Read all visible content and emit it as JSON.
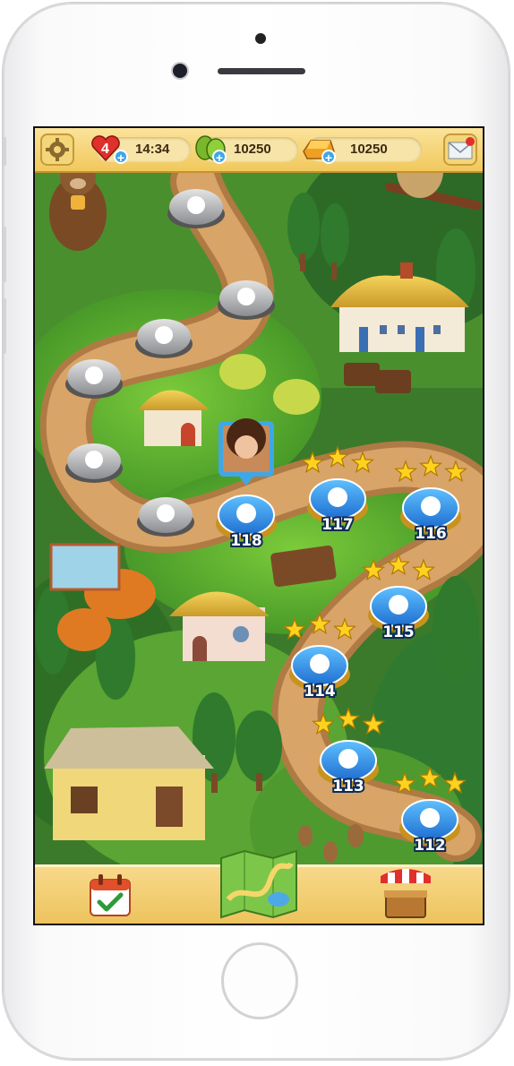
{
  "hud": {
    "lives": "4",
    "timer": "14:34",
    "boosters": "10250",
    "gold": "10250"
  },
  "levels": {
    "completed": [
      {
        "number": "118",
        "stars": 0
      },
      {
        "number": "117",
        "stars": 3
      },
      {
        "number": "116",
        "stars": 3
      },
      {
        "number": "115",
        "stars": 3
      },
      {
        "number": "114",
        "stars": 3
      },
      {
        "number": "113",
        "stars": 3
      },
      {
        "number": "112",
        "stars": 3
      }
    ],
    "current_level": "118"
  },
  "icons": {
    "settings": "gear-icon",
    "mail": "envelope-icon",
    "daily": "calendar-check-icon",
    "map": "map-icon",
    "shop": "market-stall-icon"
  },
  "colors": {
    "accent": "#3fa7e6",
    "hud_bar": "#f1c85c",
    "completed_node": "#3b8fe3",
    "locked_node": "#9a9ca0",
    "star": "#ffd21f"
  }
}
